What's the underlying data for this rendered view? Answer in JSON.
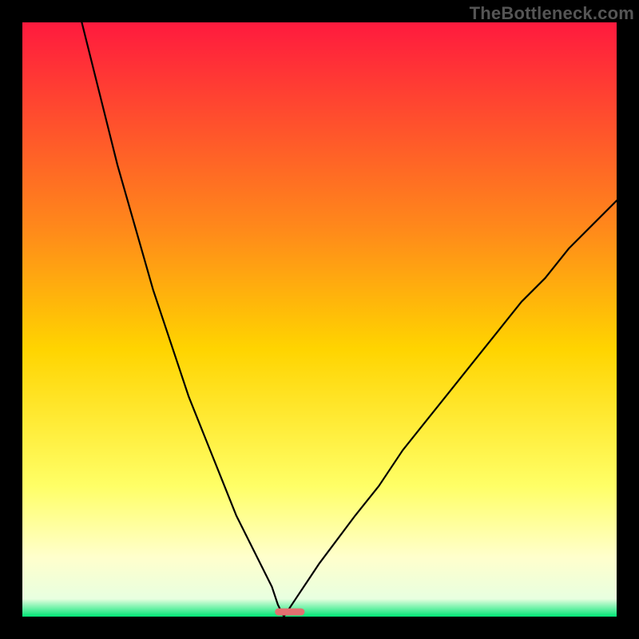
{
  "credit": "TheBottleneck.com",
  "chart_data": {
    "type": "line",
    "title": "",
    "xlabel": "",
    "ylabel": "",
    "xlim": [
      0,
      100
    ],
    "ylim": [
      0,
      100
    ],
    "colors": {
      "top": "#ff1a3e",
      "upper_mid": "#ff8a1a",
      "mid": "#ffd400",
      "lower_mid": "#ffff66",
      "pale": "#ffffcc",
      "bottom": "#00e676",
      "marker": "#e27070",
      "curve": "#000000"
    },
    "gradient_stops": [
      {
        "offset": 0.0,
        "color": "#ff1a3e"
      },
      {
        "offset": 0.35,
        "color": "#ff8a1a"
      },
      {
        "offset": 0.55,
        "color": "#ffd400"
      },
      {
        "offset": 0.78,
        "color": "#ffff66"
      },
      {
        "offset": 0.9,
        "color": "#ffffcc"
      },
      {
        "offset": 0.97,
        "color": "#e8ffe0"
      },
      {
        "offset": 1.0,
        "color": "#00e676"
      }
    ],
    "vertex_x": 44,
    "marker": {
      "x_start": 42.5,
      "x_end": 47.5,
      "y": 0.8,
      "height": 1.2
    },
    "series": [
      {
        "name": "left-branch",
        "x": [
          10,
          12,
          14,
          16,
          18,
          20,
          22,
          24,
          26,
          28,
          30,
          32,
          34,
          36,
          38,
          40,
          42,
          43,
          44
        ],
        "values": [
          100,
          92,
          84,
          76,
          69,
          62,
          55,
          49,
          43,
          37,
          32,
          27,
          22,
          17,
          13,
          9,
          5,
          2,
          0
        ]
      },
      {
        "name": "right-branch",
        "x": [
          44,
          46,
          48,
          50,
          53,
          56,
          60,
          64,
          68,
          72,
          76,
          80,
          84,
          88,
          92,
          96,
          100
        ],
        "values": [
          0,
          3,
          6,
          9,
          13,
          17,
          22,
          28,
          33,
          38,
          43,
          48,
          53,
          57,
          62,
          66,
          70
        ]
      }
    ]
  }
}
